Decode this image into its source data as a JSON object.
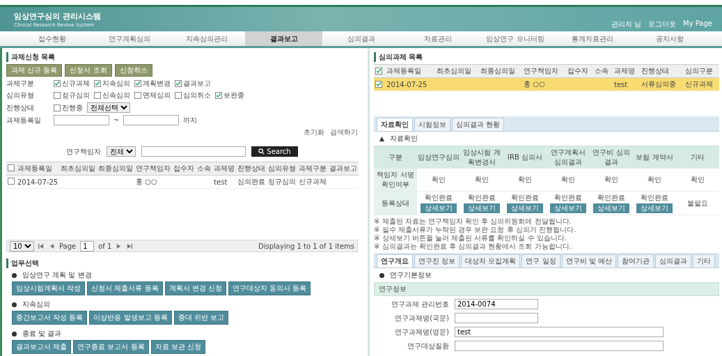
{
  "header": {
    "logo_title": "임상연구심의 관리시스템",
    "logo_subtitle": "Clinical Research Review System",
    "user_links": [
      "관리자 님",
      "로그아웃",
      "My Page"
    ]
  },
  "nav": [
    {
      "label": "접수현황",
      "selected": false
    },
    {
      "label": "연구계획심의",
      "selected": false
    },
    {
      "label": "지속심의관리",
      "selected": false
    },
    {
      "label": "결과보고",
      "selected": true
    },
    {
      "label": "심의결과",
      "selected": false
    },
    {
      "label": "자료관리",
      "selected": false
    },
    {
      "label": "임상연구 모니터링",
      "selected": false
    },
    {
      "label": "통계자료관리",
      "selected": false
    },
    {
      "label": "공지사항",
      "selected": false
    }
  ],
  "left_panel": {
    "title": "과제신청 목록",
    "action_buttons": [
      "과제 신규 등록",
      "신청서 조회",
      "신청취소"
    ],
    "filters": [
      {
        "kind": "checks",
        "label": "과제구분",
        "options": [
          {
            "label": "신규과제",
            "checked": true
          },
          {
            "label": "지속심의",
            "checked": true
          },
          {
            "label": "계획변경",
            "checked": true
          },
          {
            "label": "결과보고",
            "checked": true
          }
        ]
      },
      {
        "kind": "checks",
        "label": "심의유형",
        "options": [
          {
            "label": "정규심의",
            "checked": false
          },
          {
            "label": "신속심의",
            "checked": false
          },
          {
            "label": "면제심의",
            "checked": false
          },
          {
            "label": "심의취소",
            "checked": false
          },
          {
            "label": "보완중",
            "checked": true
          }
        ]
      },
      {
        "kind": "check_select",
        "label": "진행상태",
        "options": [
          {
            "label": "진행중",
            "checked": false
          }
        ],
        "select": "전체선택"
      },
      {
        "kind": "date_range",
        "label": "과제등록일",
        "separator": "~",
        "suffix": "까지"
      }
    ],
    "links": [
      "초기화",
      "검색하기"
    ],
    "search": {
      "select_label": "연구책임자",
      "select": "전체",
      "button": "Search"
    },
    "table": {
      "header_checked": false,
      "columns": [
        "과제등록일",
        "최초심의일",
        "최종심의일",
        "연구책임자",
        "접수자",
        "소속",
        "과제명",
        "진행상태",
        "심의유형",
        "과제구분",
        "결과보고"
      ],
      "rows": [
        {
          "checked": false,
          "cells": [
            "2014-07-25",
            null,
            null,
            "홍 ○○",
            null,
            null,
            "test",
            "심의완료",
            "정규심의",
            "신규과제",
            null
          ]
        }
      ]
    },
    "pager": {
      "page_size": "10",
      "page_label": "Page",
      "page": "1",
      "of": "of 1",
      "display": "Displaying 1 to 1 of 1 items"
    }
  },
  "tasks": {
    "title": "업무선택",
    "groups": [
      {
        "title": "임상연구 계획 및 변경",
        "buttons": [
          "임상시험계획서 작성",
          "신청서 제출서류 등록",
          "계획서 변경 신청",
          "연구대상자 동의서 등록"
        ]
      },
      {
        "title": "지속심의",
        "buttons": [
          "중간보고서 작성 등록",
          "이상반응 발생보고 등록",
          "중대 위반 보고"
        ]
      },
      {
        "title": "종료 및 결과",
        "buttons": [
          "결과보고서 제출",
          "연구종료 보고서 등록",
          "자료 보관 신청"
        ]
      }
    ]
  },
  "right_panel": {
    "title": "심의과제 목록",
    "header_checked": true,
    "table": {
      "columns": [
        "과제등록일",
        "최초심의일",
        "최종심의일",
        "연구책임자",
        "접수자",
        "소속",
        "과제명",
        "진행상태",
        "심의구분"
      ],
      "rows": [
        {
          "selected": true,
          "checked": true,
          "cells": [
            "2014-07-25",
            null,
            null,
            "홍 ○○",
            null,
            null,
            "test",
            "서류심의중",
            "신규과제"
          ]
        }
      ]
    },
    "tabs": [
      {
        "label": "자료확인",
        "selected": true
      },
      {
        "label": "시험정보",
        "selected": false
      },
      {
        "label": "심의결과 현황",
        "selected": false
      }
    ],
    "review": {
      "caption": "자료확인",
      "corner": "구분",
      "columns": [
        "임상연구심의",
        "임상시험 계획변경서",
        "IRB 심의서",
        "연구계획서 심의결과",
        "연구비 심의결과",
        "보험 계약서",
        "기타"
      ],
      "rows": [
        {
          "label": "책임자 서명 확인여부",
          "cells": [
            {
              "kind": "text",
              "status": "확인"
            },
            {
              "kind": "text",
              "status": "확인"
            },
            {
              "kind": "text",
              "status": "확인"
            },
            {
              "kind": "text",
              "status": "확인"
            },
            {
              "kind": "text",
              "status": "확인"
            },
            {
              "kind": "text",
              "status": "확인"
            },
            {
              "kind": "text",
              "status": "확인"
            }
          ]
        },
        {
          "label": "등록상태",
          "cells": [
            {
              "kind": "button",
              "status": "확인완료",
              "button": "상세보기"
            },
            {
              "kind": "button",
              "status": "확인완료",
              "button": "상세보기"
            },
            {
              "kind": "button",
              "status": "확인완료",
              "button": "상세보기"
            },
            {
              "kind": "button",
              "status": "확인완료",
              "button": "상세보기"
            },
            {
              "kind": "button",
              "status": "확인완료",
              "button": "상세보기"
            },
            {
              "kind": "button",
              "status": "확인완료",
              "button": "상세보기"
            },
            {
              "kind": "text",
              "status": "불필요"
            }
          ]
        }
      ]
    },
    "notes": [
      "※ 제출된 자료는 연구책임자 확인 후 심의위원회에 전달됩니다.",
      "※ 필수 제출서류가 누락된 경우 보완 요청 후 심의가 진행됩니다.",
      "※ 상세보기 버튼을 눌러 제출된 서류를 확인하실 수 있습니다.",
      "※ 심의결과는 확인완료 후 심의결과 현황에서 조회 가능합니다."
    ],
    "detail_tabs": [
      {
        "label": "연구개요",
        "selected": true
      },
      {
        "label": "연구진 정보",
        "selected": false
      },
      {
        "label": "대상자 모집계획",
        "selected": false
      },
      {
        "label": "연구 일정",
        "selected": false
      },
      {
        "label": "연구비 및 예산",
        "selected": false
      },
      {
        "label": "참여기관",
        "selected": false
      },
      {
        "label": "심의결과",
        "selected": false
      },
      {
        "label": "기타",
        "selected": false
      }
    ],
    "detail": {
      "caption": "연구기본정보",
      "section": "연구정보",
      "fields": [
        {
          "label": "연구과제 관리번호",
          "value": "2014-0074"
        },
        {
          "label": "연구과제명(국문)"
        },
        {
          "label": "연구과제명(영문)",
          "value": "test"
        },
        {
          "label": "연구대상질환"
        }
      ]
    }
  }
}
